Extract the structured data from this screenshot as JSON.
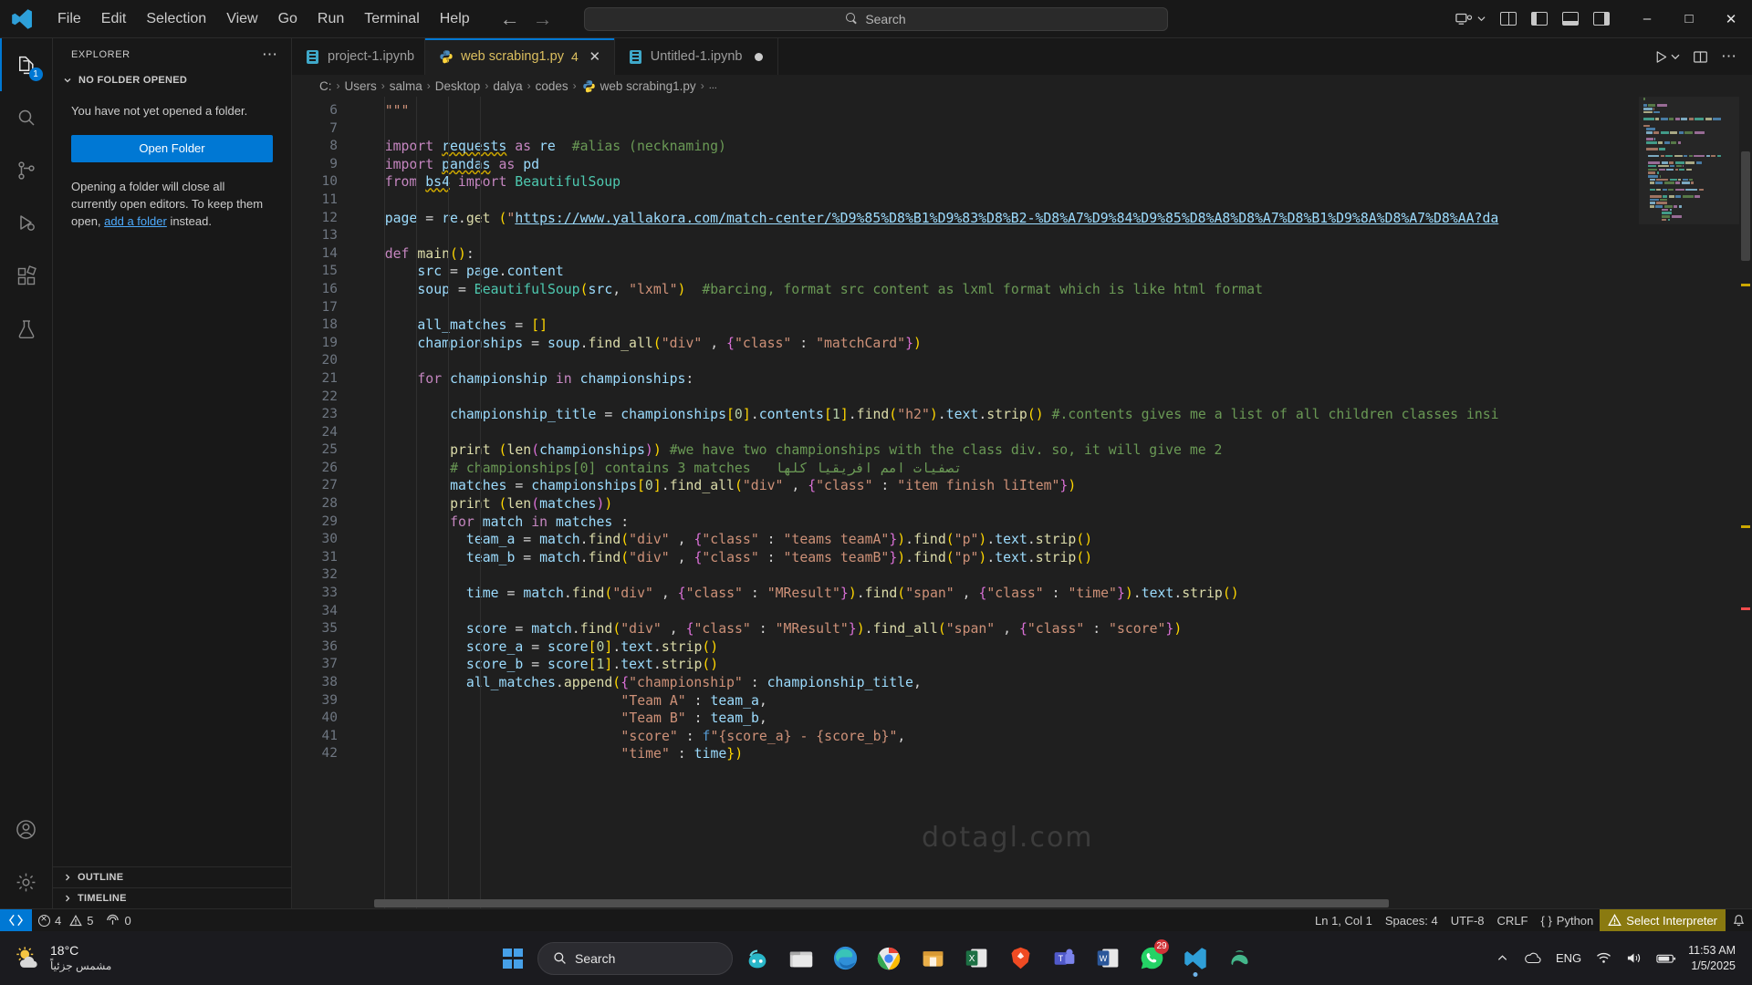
{
  "titlebar": {
    "logo_icon": "vscode-logo",
    "menus": [
      "File",
      "Edit",
      "Selection",
      "View",
      "Go",
      "Run",
      "Terminal",
      "Help"
    ],
    "nav_back_icon": "arrow-left-icon",
    "nav_forward_icon": "arrow-right-icon",
    "search_placeholder": "Search",
    "search_icon": "search-icon",
    "remote_icon": "remote-window-icon",
    "remote_chevron": "chevron-down-icon",
    "layout_icons": [
      "customize-layout-icon",
      "toggle-primary-sidebar-icon",
      "toggle-panel-icon",
      "toggle-secondary-sidebar-icon"
    ],
    "window_minimize": "minimize-icon",
    "window_maximize": "maximize-icon",
    "window_close": "close-icon"
  },
  "activitybar": {
    "items": [
      {
        "name": "explorer",
        "icon": "files-icon",
        "badge": "1",
        "active": true
      },
      {
        "name": "search",
        "icon": "search-icon",
        "badge": "",
        "active": false
      },
      {
        "name": "source-control",
        "icon": "source-control-icon",
        "badge": "",
        "active": false
      },
      {
        "name": "run-and-debug",
        "icon": "run-debug-icon",
        "badge": "",
        "active": false
      },
      {
        "name": "extensions",
        "icon": "extensions-icon",
        "badge": "",
        "active": false
      },
      {
        "name": "testing",
        "icon": "beaker-icon",
        "badge": "",
        "active": false
      }
    ],
    "bottom": [
      {
        "name": "accounts",
        "icon": "account-icon"
      },
      {
        "name": "manage",
        "icon": "gear-icon"
      }
    ]
  },
  "sidebar": {
    "title": "EXPLORER",
    "more_actions_icon": "ellipsis-icon",
    "section_title": "NO FOLDER OPENED",
    "section_chevron": "chevron-down-icon",
    "message": "You have not yet opened a folder.",
    "open_folder_label": "Open Folder",
    "hint_before": "Opening a folder will close all currently open editors. To keep them open, ",
    "hint_link": "add a folder",
    "hint_after": " instead.",
    "footer": [
      {
        "label": "OUTLINE",
        "chevron": "chevron-right-icon"
      },
      {
        "label": "TIMELINE",
        "chevron": "chevron-right-icon"
      }
    ]
  },
  "editor": {
    "tabs": [
      {
        "label": "project-1.ipynb",
        "icon": "jupyter-notebook-icon",
        "active": false,
        "dirty": false,
        "count": ""
      },
      {
        "label": "web scrabing1.py",
        "icon": "python-icon",
        "active": true,
        "dirty": false,
        "count": "4",
        "close_icon": "close-icon"
      },
      {
        "label": "Untitled-1.ipynb",
        "icon": "jupyter-notebook-icon",
        "active": false,
        "dirty": true,
        "count": ""
      }
    ],
    "actions": [
      {
        "name": "run-python-file",
        "icon": "play-icon"
      },
      {
        "name": "run-chevron",
        "icon": "chevron-down-icon"
      },
      {
        "name": "split-editor-right",
        "icon": "split-editor-icon"
      },
      {
        "name": "more-actions",
        "icon": "ellipsis-icon"
      }
    ],
    "breadcrumb": [
      "C:",
      "Users",
      "salma",
      "Desktop",
      "dalya",
      "codes",
      "web scrabing1.py",
      "..."
    ],
    "breadcrumb_file_icon": "python-icon",
    "breadcrumb_separator": "›",
    "watermark": "dotagl.com",
    "first_line_number": 6,
    "lines": [
      {
        "n": 6,
        "text": "    \"\"\""
      },
      {
        "n": 7,
        "text": ""
      },
      {
        "n": 8,
        "text": "    import requests as re  #alias (necknaming)"
      },
      {
        "n": 9,
        "text": "    import pandas as pd"
      },
      {
        "n": 10,
        "text": "    from bs4 import BeautifulSoup"
      },
      {
        "n": 11,
        "text": ""
      },
      {
        "n": 12,
        "text": "    page = re.get (\"https://www.yallakora.com/match-center/%D9%85%D8%B1%D9%83%D8%B2-%D8%A7%D9%84%D9%85%D8%A8%D8%A7%D8%B1%D9%8A%D8%A7%D8%AA?da"
      },
      {
        "n": 13,
        "text": ""
      },
      {
        "n": 14,
        "text": "    def main():"
      },
      {
        "n": 15,
        "text": "        src = page.content"
      },
      {
        "n": 16,
        "text": "        soup = BeautifulSoup(src, \"lxml\")  #barcing, format src content as lxml format which is like html format"
      },
      {
        "n": 17,
        "text": ""
      },
      {
        "n": 18,
        "text": "        all_matches = []"
      },
      {
        "n": 19,
        "text": "        championships = soup.find_all(\"div\" , {\"class\" : \"matchCard\"})"
      },
      {
        "n": 20,
        "text": ""
      },
      {
        "n": 21,
        "text": "        for championship in championships:"
      },
      {
        "n": 22,
        "text": ""
      },
      {
        "n": 23,
        "text": "            championship_title = championships[0].contents[1].find(\"h2\").text.strip() #.contents gives me a list of all children classes insi"
      },
      {
        "n": 24,
        "text": ""
      },
      {
        "n": 25,
        "text": "            print (len(championships)) #we have two championships with the class div. so, it will give me 2"
      },
      {
        "n": 26,
        "text": "            # championships[0] contains 3 matches   تصفيات امم افريقيا كلها"
      },
      {
        "n": 27,
        "text": "            matches = championships[0].find_all(\"div\" , {\"class\" : \"item finish liItem\"})"
      },
      {
        "n": 28,
        "text": "            print (len(matches))"
      },
      {
        "n": 29,
        "text": "            for match in matches :"
      },
      {
        "n": 30,
        "text": "              team_a = match.find(\"div\" , {\"class\" : \"teams teamA\"}).find(\"p\").text.strip()"
      },
      {
        "n": 31,
        "text": "              team_b = match.find(\"div\" , {\"class\" : \"teams teamB\"}).find(\"p\").text.strip()"
      },
      {
        "n": 32,
        "text": ""
      },
      {
        "n": 33,
        "text": "              time = match.find(\"div\" , {\"class\" : \"MResult\"}).find(\"span\" , {\"class\" : \"time\"}).text.strip()"
      },
      {
        "n": 34,
        "text": ""
      },
      {
        "n": 35,
        "text": "              score = match.find(\"div\" , {\"class\" : \"MResult\"}).find_all(\"span\" , {\"class\" : \"score\"})"
      },
      {
        "n": 36,
        "text": "              score_a = score[0].text.strip()"
      },
      {
        "n": 37,
        "text": "              score_b = score[1].text.strip()"
      },
      {
        "n": 38,
        "text": "              all_matches.append({\"championship\" : championship_title,"
      },
      {
        "n": 39,
        "text": "                                 \"Team A\" : team_a,"
      },
      {
        "n": 40,
        "text": "                                 \"Team B\" : team_b,"
      },
      {
        "n": 41,
        "text": "                                 \"score\" : f\"{score_a} - {score_b}\","
      },
      {
        "n": 42,
        "text": "                                 \"time\" : time})"
      }
    ]
  },
  "statusbar": {
    "remote_icon": "remote-indicator-icon",
    "errors_icon": "error-icon",
    "errors": "4",
    "warnings_icon": "warning-icon",
    "warnings": "5",
    "ports_icon": "ports-icon",
    "ports": "0",
    "cursor_position": "Ln 1, Col 1",
    "indentation": "Spaces: 4",
    "encoding": "UTF-8",
    "eol": "CRLF",
    "language_icon": "braces-icon",
    "language": "Python",
    "interpreter_warning_icon": "warning-icon",
    "interpreter": "Select Interpreter",
    "notifications_icon": "bell-icon"
  },
  "taskbar": {
    "weather_temp": "18°C",
    "weather_desc": "مشمس جزئياً",
    "weather_icon": "partly-sunny-icon",
    "start_icon": "windows-start-icon",
    "search_placeholder": "Search",
    "search_icon": "search-icon",
    "apps": [
      {
        "name": "copilot",
        "icon": "copilot-icon",
        "badge": ""
      },
      {
        "name": "file-explorer",
        "icon": "folder-icon",
        "badge": ""
      },
      {
        "name": "edge",
        "icon": "edge-icon",
        "badge": ""
      },
      {
        "name": "chrome",
        "icon": "chrome-icon",
        "badge": ""
      },
      {
        "name": "store",
        "icon": "store-icon",
        "badge": ""
      },
      {
        "name": "excel",
        "icon": "excel-icon",
        "badge": ""
      },
      {
        "name": "brave",
        "icon": "brave-icon",
        "badge": ""
      },
      {
        "name": "teams",
        "icon": "teams-icon",
        "badge": ""
      },
      {
        "name": "word",
        "icon": "word-icon",
        "badge": ""
      },
      {
        "name": "whatsapp",
        "icon": "whatsapp-icon",
        "badge": "29"
      },
      {
        "name": "vscode",
        "icon": "vscode-icon",
        "badge": ""
      },
      {
        "name": "anaconda",
        "icon": "anaconda-icon",
        "badge": ""
      }
    ],
    "tray_chevron": "chevron-up-icon",
    "tray_cloud_icon": "onedrive-icon",
    "tray_language": "ENG",
    "tray_wifi_icon": "wifi-icon",
    "tray_volume_icon": "volume-icon",
    "tray_battery_icon": "battery-icon",
    "clock_time": "11:53 AM",
    "clock_date": "1/5/2025"
  }
}
